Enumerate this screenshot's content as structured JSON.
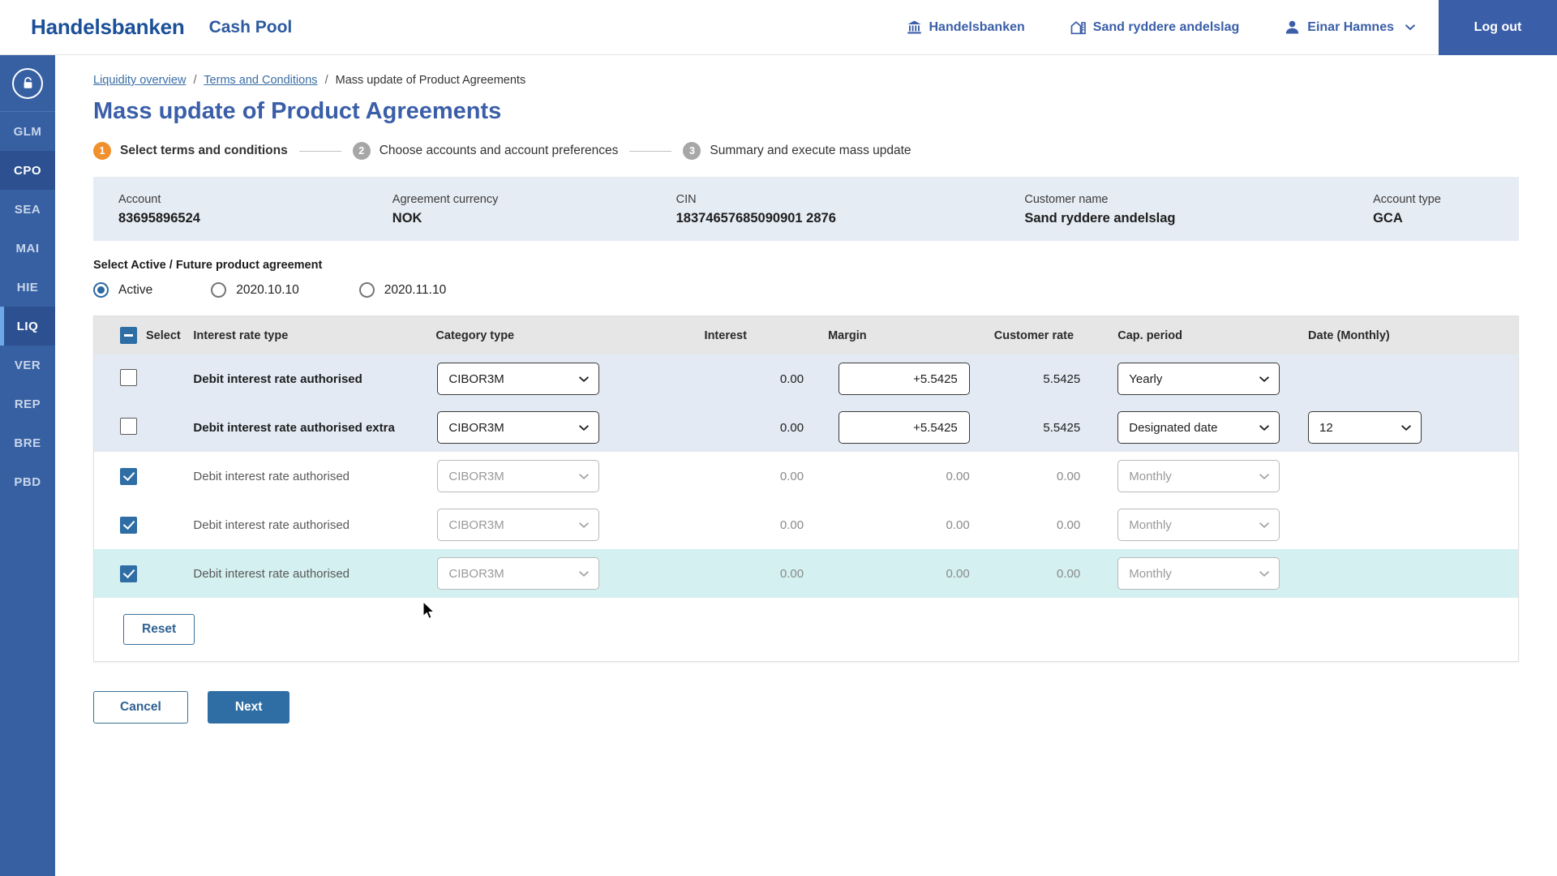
{
  "header": {
    "brand": "Handelsbanken",
    "app_name": "Cash Pool",
    "nav": [
      {
        "label": "Handelsbanken",
        "icon": "bank-icon"
      },
      {
        "label": "Sand ryddere andelslag",
        "icon": "building-icon"
      },
      {
        "label": "Einar Hamnes",
        "icon": "user-icon"
      }
    ],
    "logout_label": "Log out"
  },
  "sidebar": {
    "logo_icon": "lock-shield-icon",
    "items": [
      {
        "label": "GLM",
        "state": "normal"
      },
      {
        "label": "CPO",
        "state": "selected-dark"
      },
      {
        "label": "SEA",
        "state": "normal"
      },
      {
        "label": "MAI",
        "state": "normal"
      },
      {
        "label": "HIE",
        "state": "normal"
      },
      {
        "label": "LIQ",
        "state": "selected-active"
      },
      {
        "label": "VER",
        "state": "normal"
      },
      {
        "label": "REP",
        "state": "normal"
      },
      {
        "label": "BRE",
        "state": "normal"
      },
      {
        "label": "PBD",
        "state": "normal"
      }
    ]
  },
  "breadcrumb": {
    "items": [
      {
        "label": "Liquidity overview",
        "link": true
      },
      {
        "label": "Terms and Conditions",
        "link": true
      },
      {
        "label": "Mass update of Product Agreements",
        "link": false
      }
    ],
    "separator": "/"
  },
  "page": {
    "title": "Mass update of Product Agreements"
  },
  "stepper": {
    "steps": [
      {
        "num": "1",
        "label": "Select terms and conditions",
        "active": true
      },
      {
        "num": "2",
        "label": "Choose accounts and account preferences",
        "active": false
      },
      {
        "num": "3",
        "label": "Summary and execute mass update",
        "active": false
      }
    ]
  },
  "info_bar": [
    {
      "label": "Account",
      "value": "83695896524"
    },
    {
      "label": "Agreement currency",
      "value": "NOK"
    },
    {
      "label": "CIN",
      "value": "18374657685090901 2876"
    },
    {
      "label": "Customer name",
      "value": "Sand ryddere andelslag"
    },
    {
      "label": "Account type",
      "value": "GCA"
    }
  ],
  "agreement_select": {
    "title": "Select Active / Future product agreement",
    "options": [
      {
        "label": "Active",
        "selected": true
      },
      {
        "label": "2020.10.10",
        "selected": false
      },
      {
        "label": "2020.11.10",
        "selected": false
      }
    ]
  },
  "table": {
    "headers": {
      "select": "Select",
      "interest_rate_type": "Interest rate type",
      "category_type": "Category type",
      "interest": "Interest",
      "margin": "Margin",
      "customer_rate": "Customer rate",
      "cap_period": "Cap. period",
      "date_monthly": "Date (Monthly)"
    },
    "select_all_state": "indeterminate",
    "rows": [
      {
        "checked": false,
        "disabled": false,
        "highlighted": false,
        "interest_rate_type": "Debit interest rate authorised",
        "category_type": "CIBOR3M",
        "interest": "0.00",
        "margin": "+5.5425",
        "customer_rate": "5.5425",
        "cap_period": "Yearly",
        "date_monthly": ""
      },
      {
        "checked": false,
        "disabled": false,
        "highlighted": false,
        "interest_rate_type": "Debit interest rate authorised extra",
        "category_type": "CIBOR3M",
        "interest": "0.00",
        "margin": "+5.5425",
        "customer_rate": "5.5425",
        "cap_period": "Designated date",
        "date_monthly": "12"
      },
      {
        "checked": true,
        "disabled": true,
        "highlighted": false,
        "interest_rate_type": "Debit interest rate authorised",
        "category_type": "CIBOR3M",
        "interest": "0.00",
        "margin": "0.00",
        "customer_rate": "0.00",
        "cap_period": "Monthly",
        "date_monthly": ""
      },
      {
        "checked": true,
        "disabled": true,
        "highlighted": false,
        "interest_rate_type": "Debit interest rate authorised",
        "category_type": "CIBOR3M",
        "interest": "0.00",
        "margin": "0.00",
        "customer_rate": "0.00",
        "cap_period": "Monthly",
        "date_monthly": ""
      },
      {
        "checked": true,
        "disabled": true,
        "highlighted": true,
        "interest_rate_type": "Debit interest rate authorised",
        "category_type": "CIBOR3M",
        "interest": "0.00",
        "margin": "0.00",
        "customer_rate": "0.00",
        "cap_period": "Monthly",
        "date_monthly": ""
      }
    ],
    "reset_label": "Reset"
  },
  "footer": {
    "cancel_label": "Cancel",
    "next_label": "Next"
  },
  "colors": {
    "brand_blue": "#1b5099",
    "accent_blue": "#3a5ea8",
    "primary_button": "#2f6ea5",
    "step_active": "#f0912d",
    "step_inactive": "#a7a7a7",
    "info_bar_bg": "#e6ecf4",
    "row_editable_bg": "#e3eaf3",
    "row_hover_bg": "#d4f0f0",
    "sidebar_bg": "#3760a3",
    "sidebar_selected": "#2d5190",
    "sidebar_active_bar": "#6fa8e8"
  }
}
